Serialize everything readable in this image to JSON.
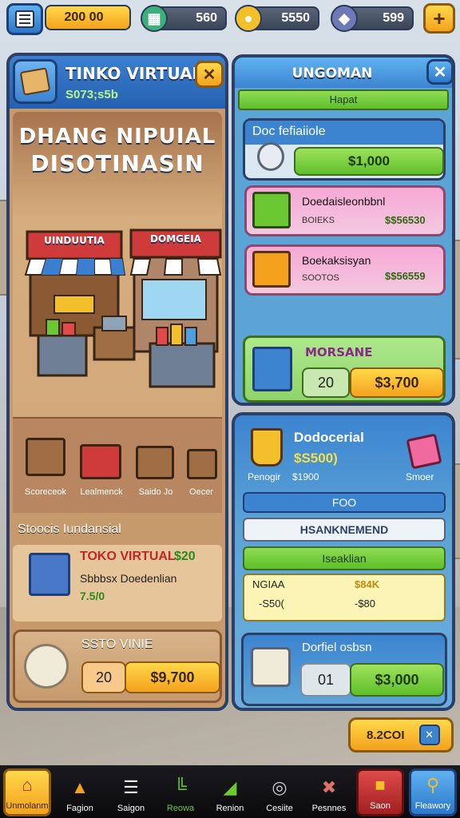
{
  "top_bar": {
    "coins": "200 00",
    "resource_2": "560",
    "resource_3": "5550",
    "resource_4": "599"
  },
  "left_panel": {
    "title": "TINKO VIRTUAN",
    "subtitle": "S073;s5b",
    "hero_line1": "DHANG NIPUIAL",
    "hero_line2": "DISOTINASIN",
    "stall_sign_1": "UINDUUTIA",
    "stall_sign_2": "DOMGEIA",
    "items": [
      {
        "label": "Scoreceok"
      },
      {
        "label": "Lealmenck"
      },
      {
        "label": "Saido Jo"
      },
      {
        "label": "Oecer"
      }
    ],
    "section_title": "Stoocis Iundansial",
    "featured": {
      "name": "TOKO VIRTUAL",
      "price": "$20",
      "desc": "Sbbbsx Doedenlian",
      "sub_price": "7.5/0"
    },
    "bottom_card": {
      "title": "SSTO VINIE",
      "qty": "20",
      "price": "$9,700"
    }
  },
  "right_panel": {
    "title": "UNGOMAN",
    "tab": "Hapat",
    "card1": {
      "title": "Doc fefiaiiole",
      "price": "$1,000"
    },
    "card2": {
      "name": "Doedaisleonbbnl",
      "sub": "BOIEKS",
      "price": "$$56530"
    },
    "card3": {
      "name": "Boekaksisyan",
      "sub": "SOOTOS",
      "price": "$$56559"
    },
    "card4": {
      "title": "MORSANE",
      "qty": "20",
      "price": "$3,700"
    }
  },
  "lower_right": {
    "title": "Dodocerial",
    "price": "$S500)",
    "item_left_label": "Penogir",
    "item_left_value": "$1900",
    "item_right_label": "Smoer",
    "bar_1": "FOO",
    "bar_2": "HSANKNEMEND",
    "bar_3": "Iseaklian",
    "table": {
      "col1_head": "NGIAA",
      "col2_head": "$84K",
      "col1_val": "-S50(",
      "col2_val": "-$80"
    },
    "bottom_card": {
      "title": "Dorfiel osbsn",
      "qty": "01",
      "price": "$3,000"
    }
  },
  "confirm_button": {
    "label": "8.2COI"
  },
  "nav": [
    {
      "label": "Unmolanm",
      "icon": "home-icon"
    },
    {
      "label": "Fagion",
      "icon": "shop-icon"
    },
    {
      "label": "Saigon",
      "icon": "list-icon"
    },
    {
      "label": "Reowa",
      "icon": "chart-icon"
    },
    {
      "label": "Renion",
      "icon": "build-icon"
    },
    {
      "label": "Cesiite",
      "icon": "gauge-icon"
    },
    {
      "label": "Pesnnes",
      "icon": "tools-icon"
    },
    {
      "label": "Saon",
      "icon": "bag-icon"
    },
    {
      "label": "Fleawory",
      "icon": "search-icon"
    }
  ],
  "colors": {
    "panel_left": "#c79a6d",
    "panel_right": "#5da4d6",
    "accent_orange": "#f4a21d",
    "accent_green": "#6cc832"
  }
}
